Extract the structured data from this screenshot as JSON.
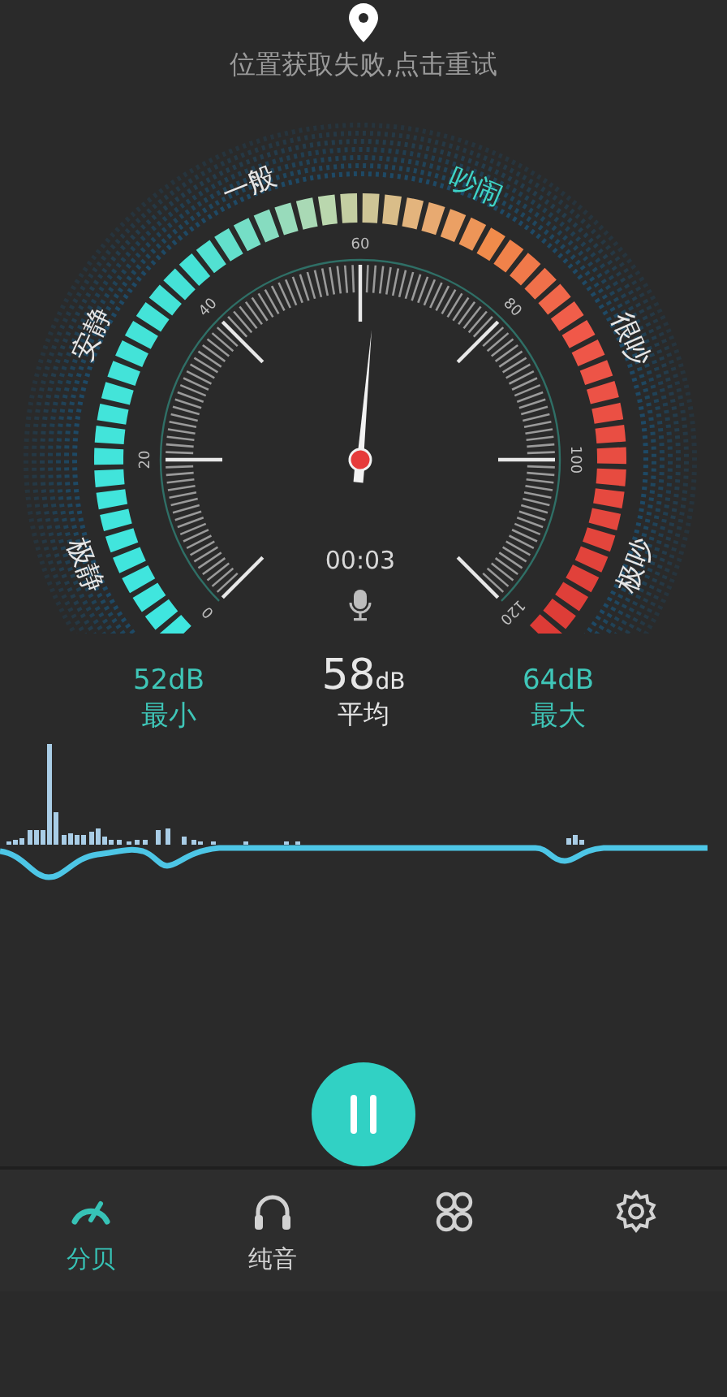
{
  "location_hint": {
    "text": "位置获取失败,点击重试"
  },
  "gauge": {
    "scale_labels": [
      "0",
      "20",
      "40",
      "60",
      "80",
      "100",
      "120"
    ],
    "zones": [
      {
        "label": "极静",
        "selected": false
      },
      {
        "label": "安静",
        "selected": false
      },
      {
        "label": "一般",
        "selected": false
      },
      {
        "label": "吵闹",
        "selected": true
      },
      {
        "label": "很吵",
        "selected": false
      },
      {
        "label": "极吵",
        "selected": false
      }
    ],
    "timer": "00:03"
  },
  "stats": [
    {
      "kind": "side",
      "value": "52",
      "unit": "dB",
      "label": "最小"
    },
    {
      "kind": "main",
      "value": "58",
      "unit": "dB",
      "label": "平均"
    },
    {
      "kind": "side",
      "value": "64",
      "unit": "dB",
      "label": "最大"
    }
  ],
  "control": {
    "running": true
  },
  "tabs": [
    {
      "kind": "gauge",
      "label": "分贝",
      "selected": true
    },
    {
      "kind": "headphones",
      "label": "纯音",
      "selected": false
    },
    {
      "kind": "cluster",
      "selected": false
    },
    {
      "kind": "settings",
      "selected": false
    }
  ]
}
